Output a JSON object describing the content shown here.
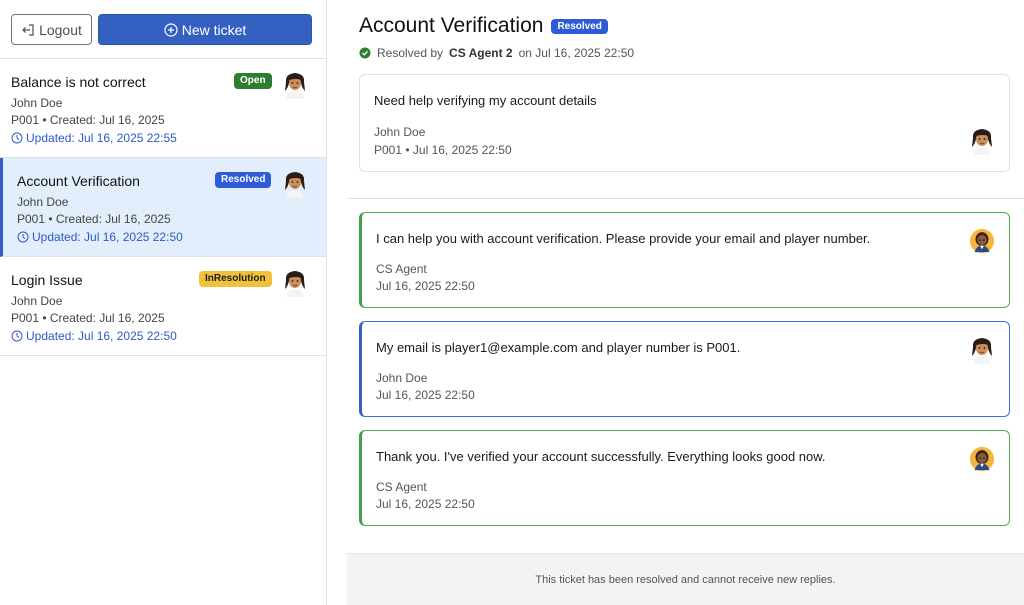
{
  "sidebar": {
    "logout_label": "Logout",
    "new_ticket_label": "New ticket",
    "tickets": [
      {
        "title": "Balance is not correct",
        "status": "Open",
        "user": "John Doe",
        "meta": "P001 • Created: Jul 16, 2025",
        "updated": "Updated: Jul 16, 2025 22:55"
      },
      {
        "title": "Account Verification",
        "status": "Resolved",
        "user": "John Doe",
        "meta": "P001 • Created: Jul 16, 2025",
        "updated": "Updated: Jul 16, 2025 22:50"
      },
      {
        "title": "Login Issue",
        "status": "InResolution",
        "user": "John Doe",
        "meta": "P001 • Created: Jul 16, 2025",
        "updated": "Updated: Jul 16, 2025 22:50"
      }
    ]
  },
  "ticket": {
    "title": "Account Verification",
    "status": "Resolved",
    "resolved_prefix": "Resolved by",
    "resolved_by": "CS Agent 2",
    "resolved_suffix": "on Jul 16, 2025 22:50",
    "original": {
      "message": "Need help verifying my account details",
      "author": "John Doe",
      "meta": "P001 • Jul 16, 2025 22:50"
    },
    "replies": [
      {
        "message": "I can help you with account verification. Please provide your email and player number.",
        "author": "CS Agent",
        "date": "Jul 16, 2025 22:50",
        "role": "agent"
      },
      {
        "message": "My email is player1@example.com and player number is P001.",
        "author": "John Doe",
        "date": "Jul 16, 2025 22:50",
        "role": "user"
      },
      {
        "message": "Thank you. I've verified your account successfully. Everything looks good now.",
        "author": "CS Agent",
        "date": "Jul 16, 2025 22:50",
        "role": "agent"
      }
    ],
    "footer_note": "This ticket has been resolved and cannot receive new replies."
  },
  "colors": {
    "primary": "#3461c1",
    "open": "#2e7d32",
    "resolved": "#2f5bd6",
    "in_resolution": "#f0c13a",
    "agent_border": "#43a047"
  },
  "icons": {
    "logout": "logout-icon",
    "new_ticket": "plus-circle-icon",
    "clock": "clock-icon",
    "check": "check-circle-icon"
  }
}
